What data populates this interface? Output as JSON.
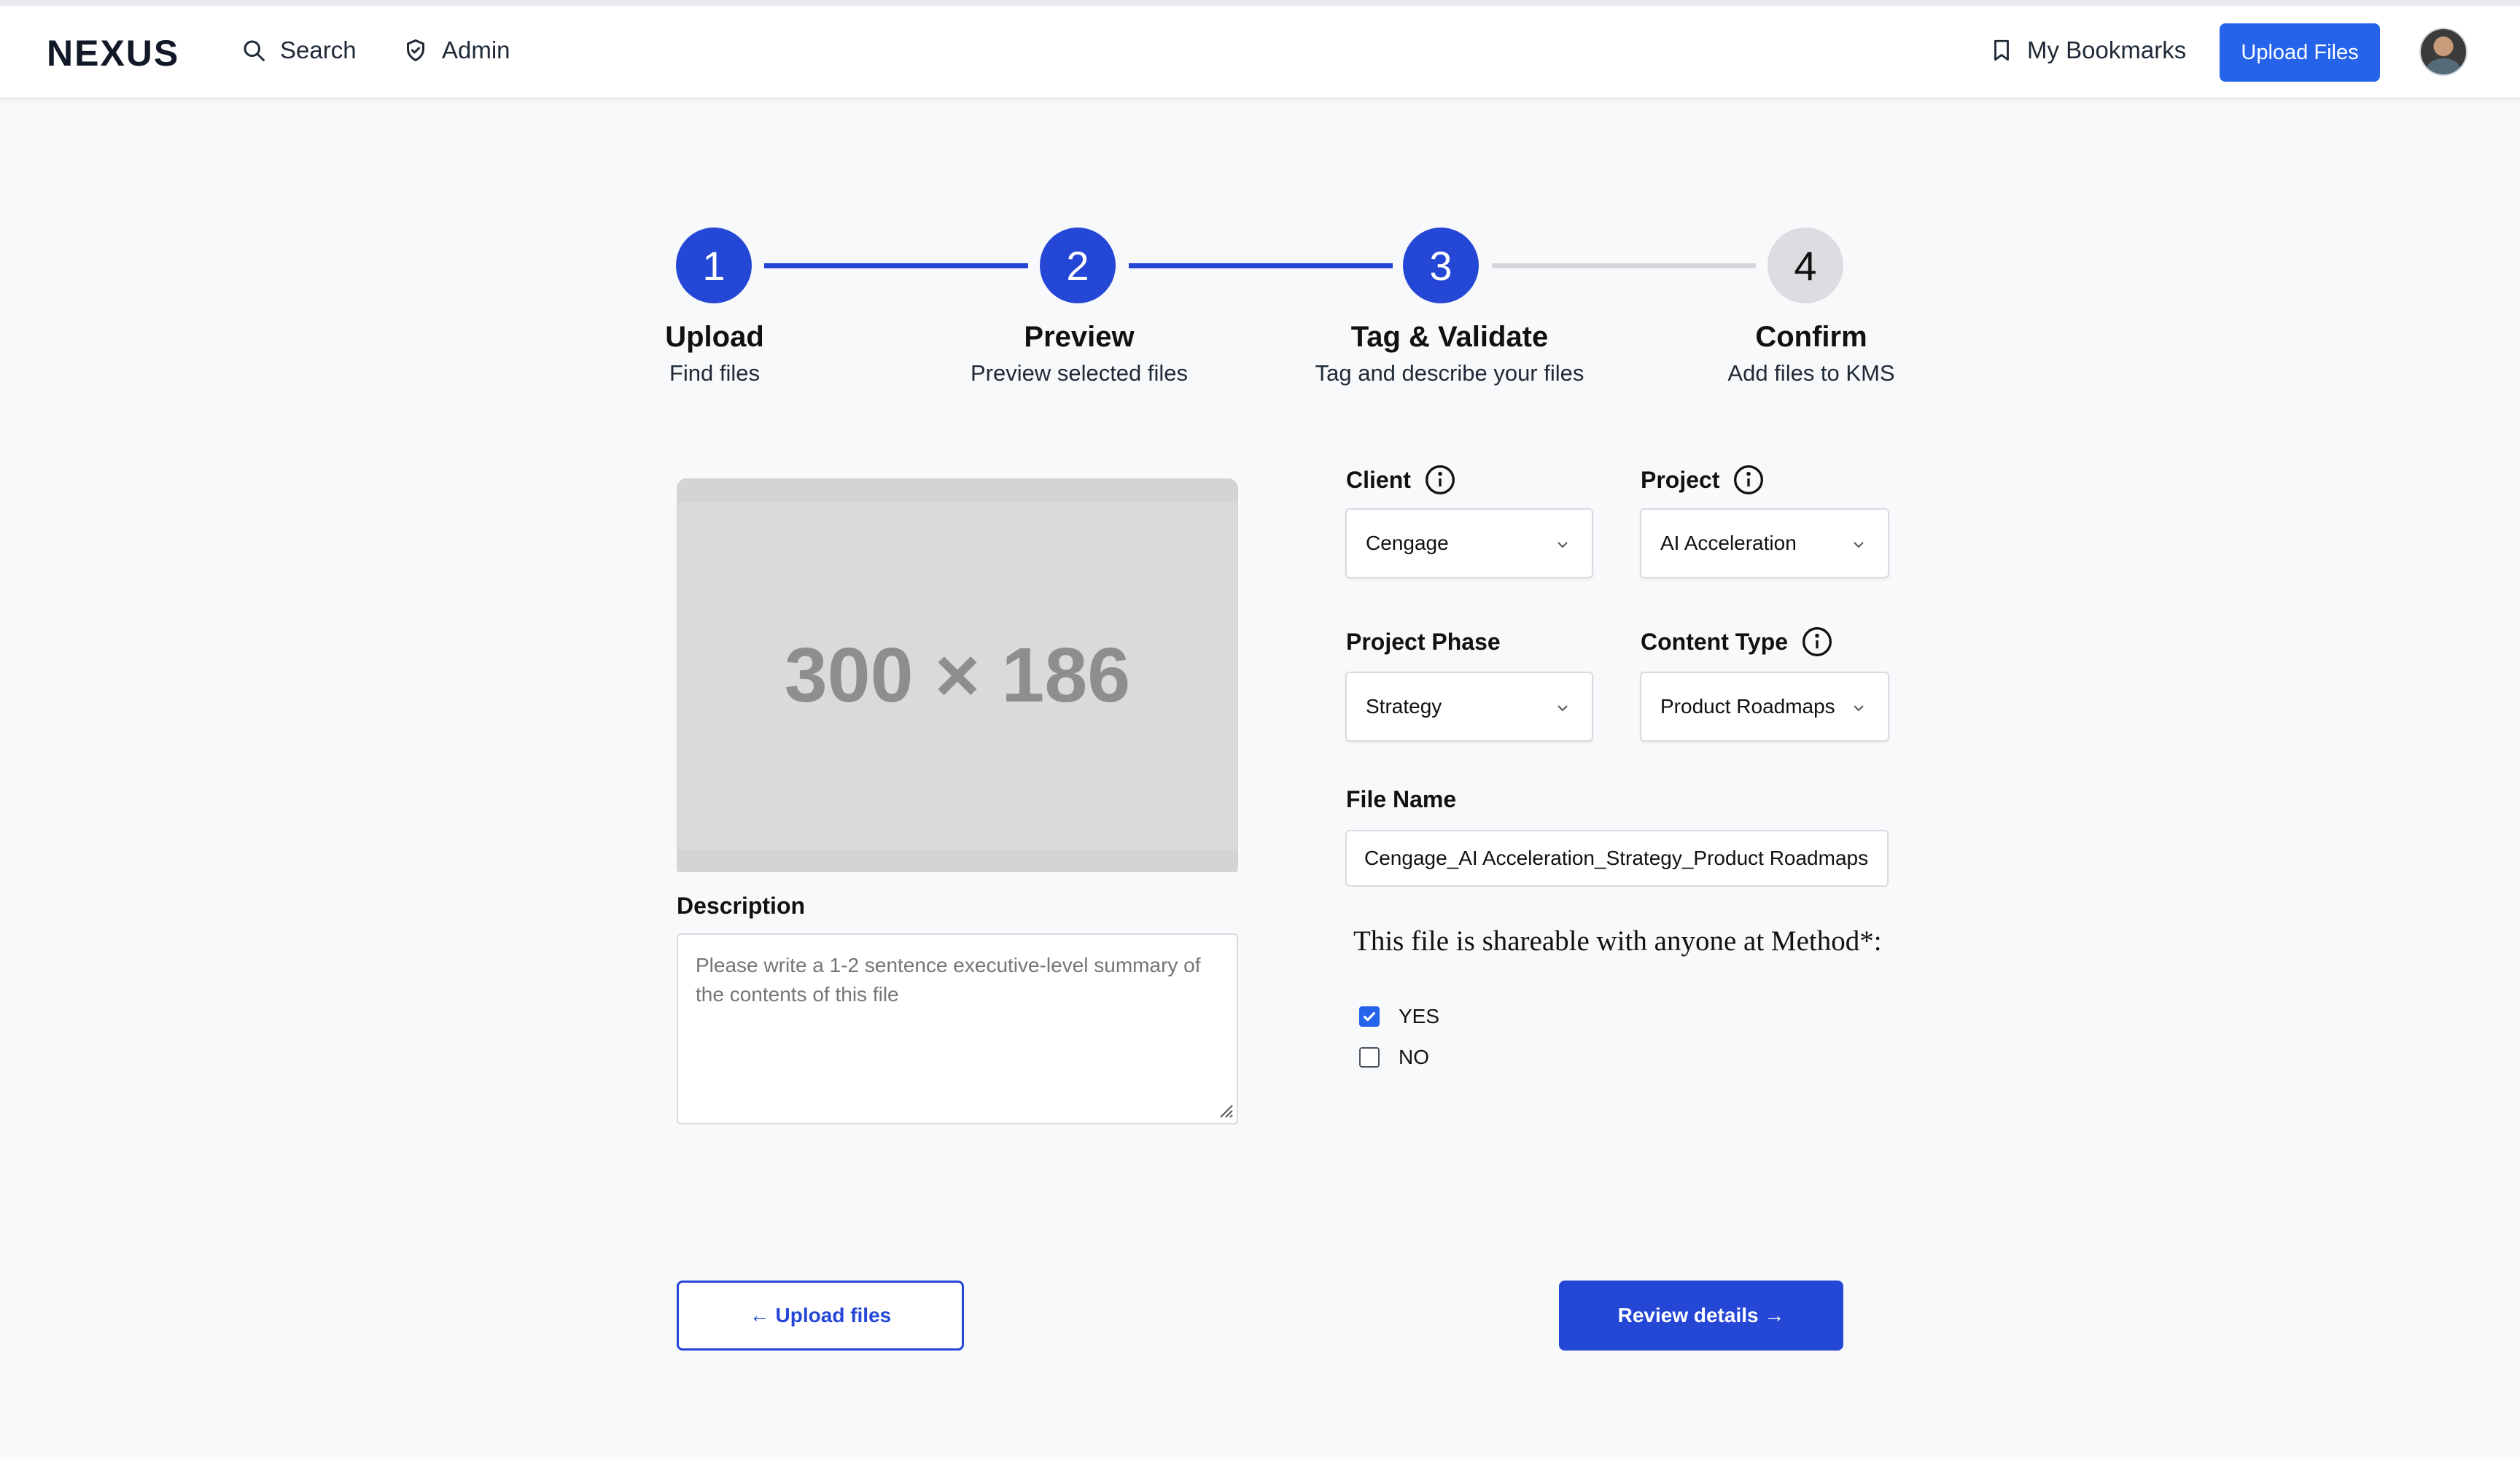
{
  "header": {
    "logo": "NEXUS",
    "nav": [
      {
        "label": "Search",
        "icon": "search-icon"
      },
      {
        "label": "Admin",
        "icon": "shield-check-icon"
      }
    ],
    "bookmarks_label": "My Bookmarks",
    "upload_label": "Upload Files",
    "accent_color": "#2563eb"
  },
  "stepper": {
    "steps": [
      {
        "number": "1",
        "title": "Upload",
        "subtitle": "Find files",
        "status": "complete"
      },
      {
        "number": "2",
        "title": "Preview",
        "subtitle": "Preview selected files",
        "status": "complete"
      },
      {
        "number": "3",
        "title": "Tag & Validate",
        "subtitle": "Tag and describe your files",
        "status": "current"
      },
      {
        "number": "4",
        "title": "Confirm",
        "subtitle": "Add files to KMS",
        "status": "upcoming"
      }
    ],
    "active_color": "#2447d6",
    "inactive_color": "#dcdde0"
  },
  "preview": {
    "placeholder_text": "300 × 186"
  },
  "description": {
    "label": "Description",
    "value": "",
    "placeholder": "Please write a 1-2 sentence executive-level summary of the contents of this file"
  },
  "form": {
    "client": {
      "label": "Client",
      "value": "Cengage"
    },
    "project": {
      "label": "Project",
      "value": "AI Acceleration"
    },
    "project_phase": {
      "label": "Project Phase",
      "value": "Strategy"
    },
    "content_type": {
      "label": "Content Type",
      "value": "Product Roadmaps"
    },
    "file_name": {
      "label": "File Name",
      "value": "Cengage_AI Acceleration_Strategy_Product Roadmaps"
    },
    "shareable": {
      "question": "This file is shareable with anyone at Method*:",
      "options": [
        {
          "label": "YES",
          "checked": true
        },
        {
          "label": "NO",
          "checked": false
        }
      ]
    }
  },
  "actions": {
    "back_label": "← Upload files",
    "next_label": "Review details →"
  }
}
